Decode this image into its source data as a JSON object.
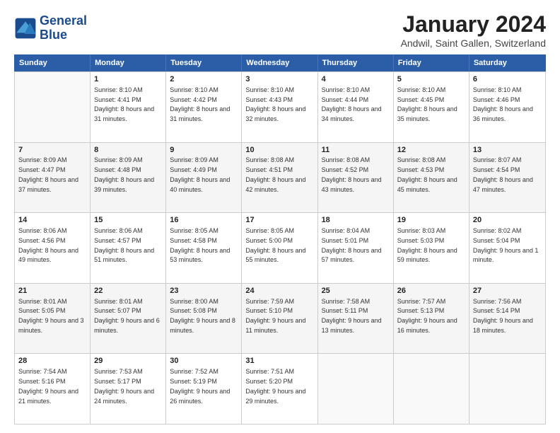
{
  "header": {
    "logo_line1": "General",
    "logo_line2": "Blue",
    "title": "January 2024",
    "subtitle": "Andwil, Saint Gallen, Switzerland"
  },
  "calendar": {
    "days": [
      "Sunday",
      "Monday",
      "Tuesday",
      "Wednesday",
      "Thursday",
      "Friday",
      "Saturday"
    ],
    "rows": [
      [
        {
          "day": "",
          "empty": true
        },
        {
          "day": "1",
          "rise": "8:10 AM",
          "set": "4:41 PM",
          "daylight": "8 hours and 31 minutes."
        },
        {
          "day": "2",
          "rise": "8:10 AM",
          "set": "4:42 PM",
          "daylight": "8 hours and 31 minutes."
        },
        {
          "day": "3",
          "rise": "8:10 AM",
          "set": "4:43 PM",
          "daylight": "8 hours and 32 minutes."
        },
        {
          "day": "4",
          "rise": "8:10 AM",
          "set": "4:44 PM",
          "daylight": "8 hours and 34 minutes."
        },
        {
          "day": "5",
          "rise": "8:10 AM",
          "set": "4:45 PM",
          "daylight": "8 hours and 35 minutes."
        },
        {
          "day": "6",
          "rise": "8:10 AM",
          "set": "4:46 PM",
          "daylight": "8 hours and 36 minutes."
        }
      ],
      [
        {
          "day": "7",
          "rise": "8:09 AM",
          "set": "4:47 PM",
          "daylight": "8 hours and 37 minutes."
        },
        {
          "day": "8",
          "rise": "8:09 AM",
          "set": "4:48 PM",
          "daylight": "8 hours and 39 minutes."
        },
        {
          "day": "9",
          "rise": "8:09 AM",
          "set": "4:49 PM",
          "daylight": "8 hours and 40 minutes."
        },
        {
          "day": "10",
          "rise": "8:08 AM",
          "set": "4:51 PM",
          "daylight": "8 hours and 42 minutes."
        },
        {
          "day": "11",
          "rise": "8:08 AM",
          "set": "4:52 PM",
          "daylight": "8 hours and 43 minutes."
        },
        {
          "day": "12",
          "rise": "8:08 AM",
          "set": "4:53 PM",
          "daylight": "8 hours and 45 minutes."
        },
        {
          "day": "13",
          "rise": "8:07 AM",
          "set": "4:54 PM",
          "daylight": "8 hours and 47 minutes."
        }
      ],
      [
        {
          "day": "14",
          "rise": "8:06 AM",
          "set": "4:56 PM",
          "daylight": "8 hours and 49 minutes."
        },
        {
          "day": "15",
          "rise": "8:06 AM",
          "set": "4:57 PM",
          "daylight": "8 hours and 51 minutes."
        },
        {
          "day": "16",
          "rise": "8:05 AM",
          "set": "4:58 PM",
          "daylight": "8 hours and 53 minutes."
        },
        {
          "day": "17",
          "rise": "8:05 AM",
          "set": "5:00 PM",
          "daylight": "8 hours and 55 minutes."
        },
        {
          "day": "18",
          "rise": "8:04 AM",
          "set": "5:01 PM",
          "daylight": "8 hours and 57 minutes."
        },
        {
          "day": "19",
          "rise": "8:03 AM",
          "set": "5:03 PM",
          "daylight": "8 hours and 59 minutes."
        },
        {
          "day": "20",
          "rise": "8:02 AM",
          "set": "5:04 PM",
          "daylight": "9 hours and 1 minute."
        }
      ],
      [
        {
          "day": "21",
          "rise": "8:01 AM",
          "set": "5:05 PM",
          "daylight": "9 hours and 3 minutes."
        },
        {
          "day": "22",
          "rise": "8:01 AM",
          "set": "5:07 PM",
          "daylight": "9 hours and 6 minutes."
        },
        {
          "day": "23",
          "rise": "8:00 AM",
          "set": "5:08 PM",
          "daylight": "9 hours and 8 minutes."
        },
        {
          "day": "24",
          "rise": "7:59 AM",
          "set": "5:10 PM",
          "daylight": "9 hours and 11 minutes."
        },
        {
          "day": "25",
          "rise": "7:58 AM",
          "set": "5:11 PM",
          "daylight": "9 hours and 13 minutes."
        },
        {
          "day": "26",
          "rise": "7:57 AM",
          "set": "5:13 PM",
          "daylight": "9 hours and 16 minutes."
        },
        {
          "day": "27",
          "rise": "7:56 AM",
          "set": "5:14 PM",
          "daylight": "9 hours and 18 minutes."
        }
      ],
      [
        {
          "day": "28",
          "rise": "7:54 AM",
          "set": "5:16 PM",
          "daylight": "9 hours and 21 minutes."
        },
        {
          "day": "29",
          "rise": "7:53 AM",
          "set": "5:17 PM",
          "daylight": "9 hours and 24 minutes."
        },
        {
          "day": "30",
          "rise": "7:52 AM",
          "set": "5:19 PM",
          "daylight": "9 hours and 26 minutes."
        },
        {
          "day": "31",
          "rise": "7:51 AM",
          "set": "5:20 PM",
          "daylight": "9 hours and 29 minutes."
        },
        {
          "day": "",
          "empty": true
        },
        {
          "day": "",
          "empty": true
        },
        {
          "day": "",
          "empty": true
        }
      ]
    ]
  }
}
